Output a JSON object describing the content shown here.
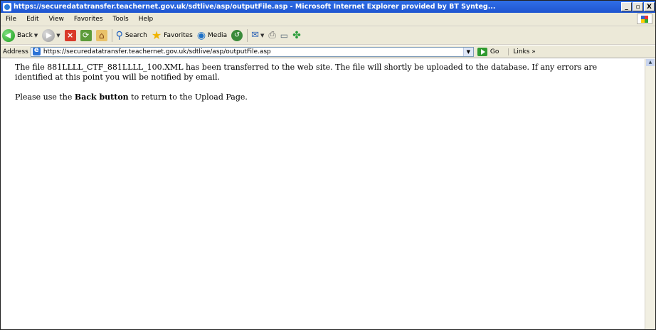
{
  "window": {
    "title": "https://securedatatransfer.teachernet.gov.uk/sdtlive/asp/outputFile.asp - Microsoft Internet Explorer provided by BT Synteg...",
    "minimize": "_",
    "maximize": "̷",
    "close": "X"
  },
  "menu": {
    "items": [
      "File",
      "Edit",
      "View",
      "Favorites",
      "Tools",
      "Help"
    ]
  },
  "toolbar": {
    "back_label": "Back",
    "search_label": "Search",
    "favorites_label": "Favorites",
    "media_label": "Media"
  },
  "address": {
    "label": "Address",
    "url": "https://securedatatransfer.teachernet.gov.uk/sdtlive/asp/outputFile.asp",
    "go_label": "Go",
    "links_label": "Links »"
  },
  "page": {
    "paragraph1": "The file 881LLLL_CTF_881LLLL_100.XML has been transferred to the web site. The file will shortly be uploaded to the database. If any errors are identified at this point you will be notified by email.",
    "paragraph2_prefix": "Please use the ",
    "paragraph2_bold": "Back button",
    "paragraph2_suffix": " to return to the Upload Page."
  }
}
